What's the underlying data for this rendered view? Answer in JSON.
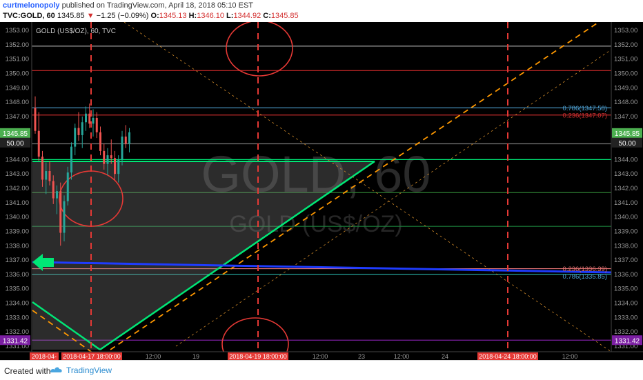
{
  "header": {
    "author": "curtmelonopoly",
    "published_text": "published on TradingView.com, April 18, 2018 05:10 EST",
    "symbol": "TVC:GOLD, 60",
    "last": "1345.85",
    "change": "−1.25 (−0.09%)",
    "o_label": "O:",
    "o_value": "1345.13",
    "h_label": "H:",
    "h_value": "1346.10",
    "l_label": "L:",
    "l_value": "1344.92",
    "c_label": "C:",
    "c_value": "1345.85"
  },
  "footer": {
    "created_with": "Created with",
    "brand": "TradingView"
  },
  "chart_data": {
    "type": "candlestick",
    "legend": "GOLD (US$/OZ), 60, TVC",
    "watermark_symbol": "GOLD, 60",
    "watermark_name": "GOLD (US$/OZ)",
    "ylim": [
      1330.5,
      1353.5
    ],
    "y_ticks": [
      "1353.00",
      "1352.00",
      "1351.00",
      "1350.00",
      "1349.00",
      "1348.00",
      "1347.00",
      "1346.00",
      "1345.00",
      "1344.00",
      "1343.00",
      "1342.00",
      "1341.00",
      "1340.00",
      "1339.00",
      "1338.00",
      "1337.00",
      "1336.00",
      "1335.00",
      "1334.00",
      "1333.00",
      "1332.00",
      "1331.00"
    ],
    "x_ticks": [
      "2018-04-",
      "2018-04-17 18:00:00",
      "12:00",
      "19",
      "2018-04-19 18:00:00",
      "12:00",
      "23",
      "12:00",
      "24",
      "2018-04-24 18:00:00",
      "12:00"
    ],
    "price_badges": {
      "price": "1345.85",
      "scale": "50.00",
      "bottom": "1331.42"
    },
    "levels": [
      {
        "price": 1351.9,
        "color": "#9e9e9e"
      },
      {
        "price": 1350.2,
        "color": "#c62828"
      },
      {
        "price": 1347.6,
        "color": "#4fa3d6"
      },
      {
        "price": 1347.1,
        "color": "#d32f2f"
      },
      {
        "price": 1345.1,
        "color": "#777777"
      },
      {
        "price": 1344.0,
        "color": "#00e676"
      },
      {
        "price": 1341.7,
        "color": "#2e7d32"
      },
      {
        "price": 1339.35,
        "color": "#1b7f3a"
      },
      {
        "price": 1336.4,
        "color": "#e57373"
      },
      {
        "price": 1336.0,
        "color": "#26a69a"
      },
      {
        "price": 1331.42,
        "color": "#7b1fa2"
      }
    ],
    "fib_labels": [
      {
        "text": "0.786(1347.58)",
        "price": 1347.58,
        "color": "#4fa3d6"
      },
      {
        "text": "0.236(1347.07)",
        "price": 1347.07,
        "color": "#d32f2f"
      },
      {
        "text": "0.236(1336.39)",
        "price": 1336.39,
        "color": "#e57373"
      },
      {
        "text": "0.786(1335.85)",
        "price": 1335.85,
        "color": "#4fa3d6"
      }
    ],
    "candles": [
      {
        "o": 1347.6,
        "h": 1348.4,
        "l": 1345.8,
        "c": 1346.0
      },
      {
        "o": 1346.0,
        "h": 1347.3,
        "l": 1343.9,
        "c": 1344.2
      },
      {
        "o": 1344.2,
        "h": 1344.6,
        "l": 1342.1,
        "c": 1342.6
      },
      {
        "o": 1342.6,
        "h": 1343.8,
        "l": 1341.6,
        "c": 1343.2
      },
      {
        "o": 1343.2,
        "h": 1343.9,
        "l": 1342.2,
        "c": 1342.5
      },
      {
        "o": 1342.5,
        "h": 1342.9,
        "l": 1340.9,
        "c": 1341.3
      },
      {
        "o": 1341.3,
        "h": 1342.2,
        "l": 1340.2,
        "c": 1341.8
      },
      {
        "o": 1341.8,
        "h": 1342.4,
        "l": 1338.0,
        "c": 1338.9
      },
      {
        "o": 1338.9,
        "h": 1341.5,
        "l": 1338.3,
        "c": 1341.1
      },
      {
        "o": 1341.1,
        "h": 1343.5,
        "l": 1340.8,
        "c": 1343.1
      },
      {
        "o": 1343.1,
        "h": 1345.2,
        "l": 1342.6,
        "c": 1344.9
      },
      {
        "o": 1344.9,
        "h": 1346.5,
        "l": 1344.3,
        "c": 1346.2
      },
      {
        "o": 1346.2,
        "h": 1347.3,
        "l": 1345.3,
        "c": 1345.7
      },
      {
        "o": 1345.7,
        "h": 1347.0,
        "l": 1344.8,
        "c": 1346.6
      },
      {
        "o": 1346.6,
        "h": 1347.7,
        "l": 1346.0,
        "c": 1347.2
      },
      {
        "o": 1347.2,
        "h": 1347.9,
        "l": 1346.2,
        "c": 1346.5
      },
      {
        "o": 1346.5,
        "h": 1347.5,
        "l": 1345.6,
        "c": 1346.9
      },
      {
        "o": 1346.9,
        "h": 1347.3,
        "l": 1345.5,
        "c": 1345.9
      },
      {
        "o": 1345.9,
        "h": 1346.3,
        "l": 1344.3,
        "c": 1344.6
      },
      {
        "o": 1344.6,
        "h": 1345.1,
        "l": 1343.3,
        "c": 1343.7
      },
      {
        "o": 1343.7,
        "h": 1344.8,
        "l": 1342.9,
        "c": 1344.3
      },
      {
        "o": 1344.3,
        "h": 1345.4,
        "l": 1343.7,
        "c": 1344.1
      },
      {
        "o": 1344.1,
        "h": 1344.6,
        "l": 1342.6,
        "c": 1343.0
      },
      {
        "o": 1343.0,
        "h": 1344.3,
        "l": 1342.4,
        "c": 1344.0
      },
      {
        "o": 1344.0,
        "h": 1346.0,
        "l": 1343.6,
        "c": 1345.6
      },
      {
        "o": 1345.6,
        "h": 1346.4,
        "l": 1344.8,
        "c": 1345.1
      },
      {
        "o": 1345.1,
        "h": 1346.2,
        "l": 1344.5,
        "c": 1345.9
      }
    ]
  }
}
